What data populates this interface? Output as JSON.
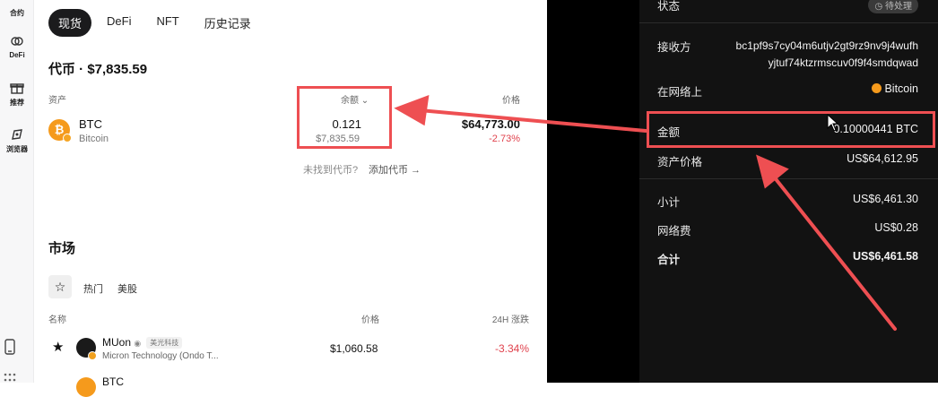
{
  "rail": {
    "items": [
      {
        "label": "合约",
        "icon": "contract-icon"
      },
      {
        "label": "DeFi",
        "icon": "defi-icon"
      },
      {
        "label": "推荐",
        "icon": "gift-icon"
      },
      {
        "label": "浏览器",
        "icon": "compass-icon"
      }
    ]
  },
  "tabs": [
    "现货",
    "DeFi",
    "NFT",
    "历史记录"
  ],
  "tokens": {
    "title": "代币 · $7,835.59",
    "col_asset": "资产",
    "col_balance": "余额",
    "col_price": "价格",
    "rows": [
      {
        "symbol": "BTC",
        "name": "Bitcoin",
        "balance": "0.121",
        "balance_fiat": "$7,835.59",
        "price": "$64,773.00",
        "change": "-2.73%"
      }
    ],
    "missing": "未找到代币?",
    "add": "添加代币 →"
  },
  "market": {
    "title": "市场",
    "filters": [
      "热门",
      "美股"
    ],
    "col_name": "名称",
    "col_price": "价格",
    "col_change": "24H 涨跌",
    "rows": [
      {
        "symbol": "MUon",
        "tag": "美光科技",
        "name": "Micron Technology (Ondo T...",
        "price": "$1,060.58",
        "change": "-3.34%"
      },
      {
        "symbol": "BTC",
        "tag": "",
        "name": "",
        "price": "",
        "change": ""
      }
    ]
  },
  "panel": {
    "status_label": "状态",
    "status_value": "待处理",
    "receiver_label": "接收方",
    "receiver_line1": "bc1pf9s7cy04m6utjv2gt9rz9nv9j4wufh",
    "receiver_line2": "yjtuf74ktzrmscuv0f9f4smdqwad",
    "network_label": "在网络上",
    "network_value": "Bitcoin",
    "amount_label": "金额",
    "amount_value": "0.10000441 BTC",
    "asset_price_label": "资产价格",
    "asset_price_value": "US$64,612.95",
    "subtotal_label": "小计",
    "subtotal_value": "US$6,461.30",
    "fee_label": "网络费",
    "fee_value": "US$0.28",
    "total_label": "合计",
    "total_value": "US$6,461.58"
  },
  "colors": {
    "highlight": "#ee4f52",
    "btc": "#f59a1c",
    "negative": "#e0424d"
  }
}
